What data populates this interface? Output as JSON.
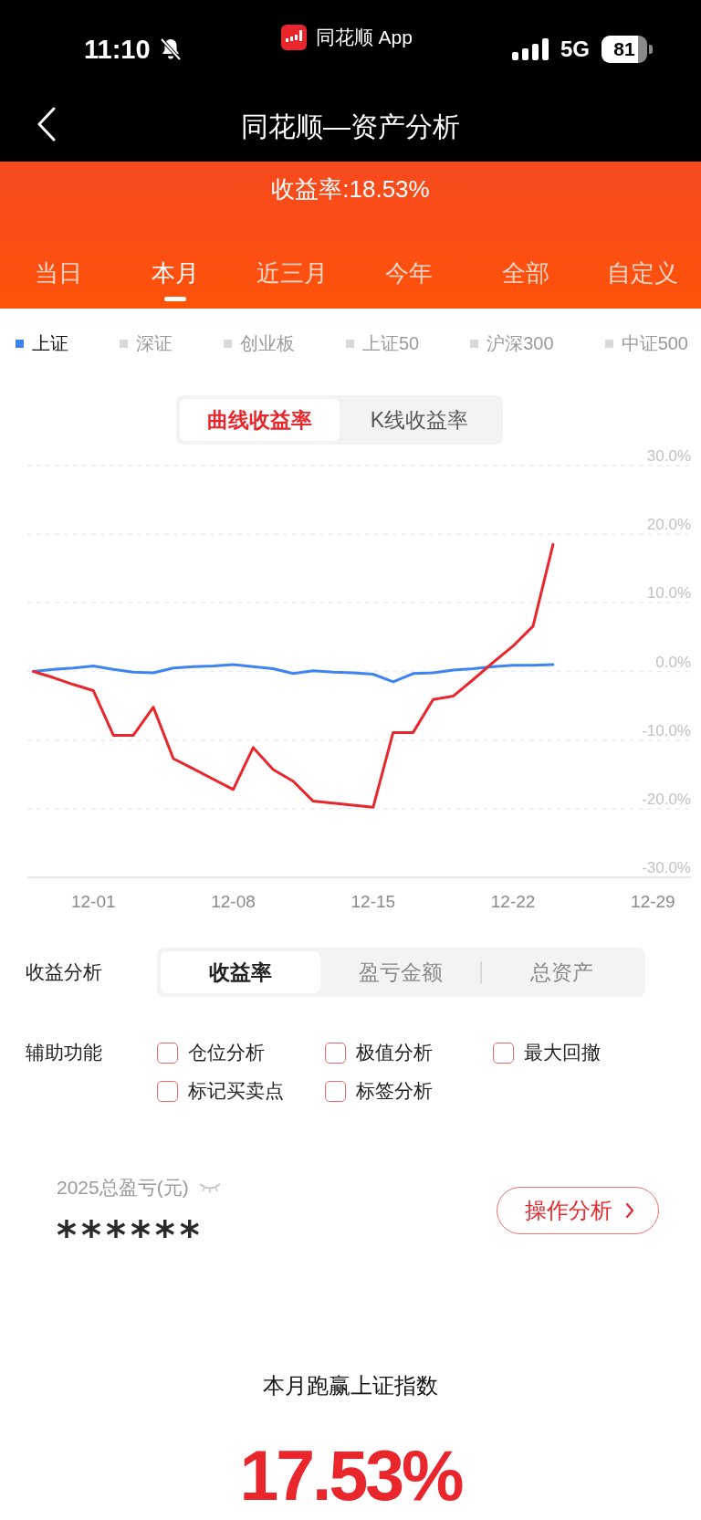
{
  "status_bar": {
    "time": "11:10",
    "app_label": "同花顺 App",
    "network": "5G",
    "battery": "81"
  },
  "nav_bar": {
    "title": "同花顺—资产分析"
  },
  "summary": {
    "text": "收益率:18.53%"
  },
  "period_tabs": [
    {
      "label": "当日",
      "selected": false
    },
    {
      "label": "本月",
      "selected": true
    },
    {
      "label": "近三月",
      "selected": false
    },
    {
      "label": "今年",
      "selected": false
    },
    {
      "label": "全部",
      "selected": false
    },
    {
      "label": "自定义",
      "selected": false
    }
  ],
  "index_legend": [
    {
      "label": "上证",
      "selected": true
    },
    {
      "label": "深证",
      "selected": false
    },
    {
      "label": "创业板",
      "selected": false
    },
    {
      "label": "上证50",
      "selected": false
    },
    {
      "label": "沪深300",
      "selected": false
    },
    {
      "label": "中证500",
      "selected": false
    }
  ],
  "chart_modes": [
    {
      "label": "曲线收益率",
      "selected": true
    },
    {
      "label": "K线收益率",
      "selected": false
    }
  ],
  "chart": {
    "chart_data": {
      "type": "line",
      "categories": [
        null,
        null,
        null,
        "12-01",
        null,
        null,
        null,
        null,
        null,
        null,
        "12-08",
        null,
        null,
        null,
        null,
        null,
        null,
        "12-15",
        null,
        null,
        null,
        null,
        null,
        null,
        "12-22",
        null,
        null,
        null,
        null,
        null,
        null,
        "12-29"
      ],
      "series": [
        {
          "color": "#3d84f2",
          "values": [
            0,
            0.3,
            0.5,
            0.8,
            0.3,
            -0.1,
            -0.2,
            0.5,
            0.7,
            0.8,
            1.0,
            0.7,
            0.4,
            -0.3,
            0.1,
            -0.1,
            -0.2,
            -0.4,
            -1.5,
            -0.3,
            -0.2,
            0.2,
            0.4,
            0.7,
            0.9,
            0.9,
            1.0,
            null,
            null,
            null,
            null,
            null
          ]
        },
        {
          "color": "#e8262b",
          "values": [
            0,
            -0.9,
            -1.9,
            -2.8,
            -9.3,
            -9.3,
            -5.2,
            -12.7,
            -14.2,
            -15.7,
            -17.2,
            -11.1,
            -14.3,
            -16.0,
            -18.9,
            -19.2,
            -19.5,
            -19.8,
            -8.9,
            -8.9,
            -4.1,
            -3.6,
            -1.2,
            1.3,
            3.7,
            6.6,
            18.5,
            null,
            null,
            null,
            null,
            null
          ]
        }
      ],
      "ylim": [
        -30,
        30
      ],
      "yticks": [
        {
          "value": 30,
          "label": "30.0%"
        },
        {
          "value": 20,
          "label": "20.0%"
        },
        {
          "value": 10,
          "label": "10.0%"
        },
        {
          "value": 0,
          "label": "0.0%"
        },
        {
          "value": -10,
          "label": "-10.0%"
        },
        {
          "value": -20,
          "label": "-20.0%"
        },
        {
          "value": -30,
          "label": "-30.0%"
        }
      ],
      "grid": true
    }
  },
  "profit_analysis": {
    "label": "收益分析",
    "options": [
      {
        "label": "收益率",
        "selected": true
      },
      {
        "label": "盈亏金额",
        "selected": false
      },
      {
        "label": "总资产",
        "selected": false
      }
    ]
  },
  "aux_functions": {
    "label": "辅助功能",
    "options": [
      {
        "label": "仓位分析",
        "checked": false
      },
      {
        "label": "极值分析",
        "checked": false
      },
      {
        "label": "最大回撤",
        "checked": false
      },
      {
        "label": "标记买卖点",
        "checked": false
      },
      {
        "label": "标签分析",
        "checked": false
      }
    ]
  },
  "total_pnl": {
    "label": "2025总盈亏(元)",
    "value": "******",
    "button": "操作分析"
  },
  "beat_index": {
    "label": "本月跑赢上证指数",
    "value": "17.53%"
  }
}
